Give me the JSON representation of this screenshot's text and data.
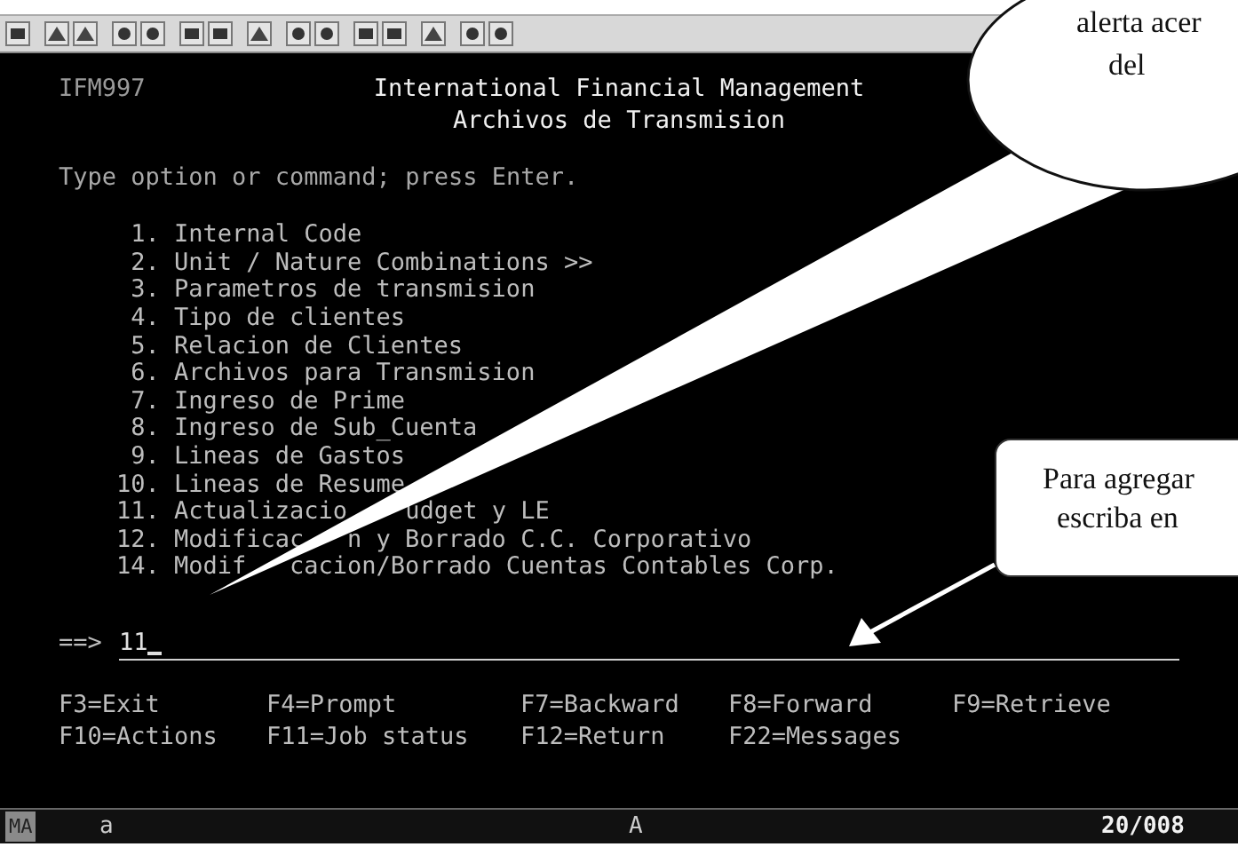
{
  "screen": {
    "program_id": "IFM997",
    "title": "International Financial Management",
    "subtitle": "Archivos de Transmision",
    "instruction": "Type option or command; press Enter.",
    "menu": [
      {
        "number": "1.",
        "parts": [
          "Internal Code"
        ]
      },
      {
        "number": "2.",
        "parts": [
          "Unit / Nature Combinations >>"
        ]
      },
      {
        "number": "3.",
        "parts": [
          "Parametros de transmision"
        ]
      },
      {
        "number": "4.",
        "parts": [
          "Tipo de clientes"
        ]
      },
      {
        "number": "5.",
        "parts": [
          "Relacion de Clientes"
        ]
      },
      {
        "number": "6.",
        "parts": [
          "Archivos para Transmision"
        ]
      },
      {
        "number": "7.",
        "parts": [
          "Ingreso de Prime"
        ]
      },
      {
        "number": "8.",
        "parts": [
          "Ingreso de Sub_Cuenta"
        ]
      },
      {
        "number": "9.",
        "parts": [
          "Lineas de Gastos"
        ]
      },
      {
        "number": "10.",
        "parts": [
          "Lineas de Resume"
        ]
      },
      {
        "number": "11.",
        "parts": [
          "Actualizacio",
          "udget y LE"
        ]
      },
      {
        "number": "12.",
        "parts": [
          "Modificac",
          "n y Borrado C.C. Corporativo"
        ]
      },
      {
        "number": "14.",
        "parts": [
          "Modif",
          "cacion/Borrado Cuentas Contables Corp."
        ]
      }
    ],
    "command": {
      "prompt": "==>",
      "value": "11"
    },
    "function_keys": [
      [
        "F3=Exit",
        "F4=Prompt",
        "F7=Backward",
        "F8=Forward",
        "F9=Retrieve"
      ],
      [
        "F10=Actions",
        "F11=Job status",
        "F12=Return",
        "F22=Messages"
      ]
    ]
  },
  "status_bar": {
    "indicator": "MA",
    "input_mode": "a",
    "shift": "A",
    "cursor_position": "20/008"
  },
  "callouts": [
    {
      "kind": "bubble",
      "lines": [
        "alerta acer",
        "del"
      ]
    },
    {
      "kind": "box",
      "lines": [
        "Para agregar",
        "escriba en"
      ]
    }
  ]
}
